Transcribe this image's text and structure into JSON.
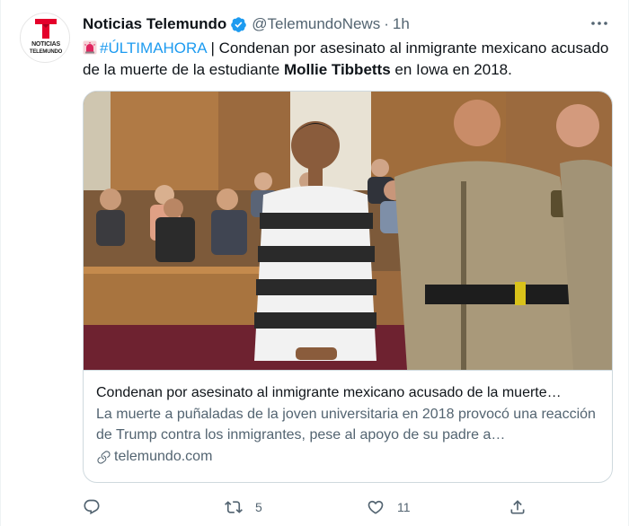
{
  "tweet": {
    "author_name": "Noticias Telemundo",
    "handle": "@TelemundoNews",
    "separator": "·",
    "time": "1h",
    "avatar_text_line1": "NOTICIAS",
    "avatar_text_line2": "TELEMUNDO",
    "text": {
      "hashtag": "#ÚLTIMAHORA",
      "part1": " | Condenan por asesinato al inmigrante mexicano acusado de la muerte de la estudiante ",
      "bold_name": "Mollie Tibbetts",
      "part2": " en Iowa en 2018."
    }
  },
  "card": {
    "title": "Condenan por asesinato al inmigrante mexicano acusado de la muerte…",
    "description": "La muerte a puñaladas de la joven universitaria en 2018 provocó una reacción de Trump contra los inmigrantes, pese al apoyo de su padre a…",
    "domain": "telemundo.com"
  },
  "actions": {
    "reply_count": "",
    "retweet_count": "5",
    "like_count": "11"
  },
  "colors": {
    "accent": "#1d9bf0",
    "secondary_text": "#536471",
    "telemundo_red": "#e4002b"
  },
  "icons": [
    "telemundo-logo-icon",
    "verified-badge-icon",
    "more-options-icon",
    "siren-icon",
    "link-icon",
    "reply-icon",
    "retweet-icon",
    "like-icon",
    "share-icon"
  ]
}
